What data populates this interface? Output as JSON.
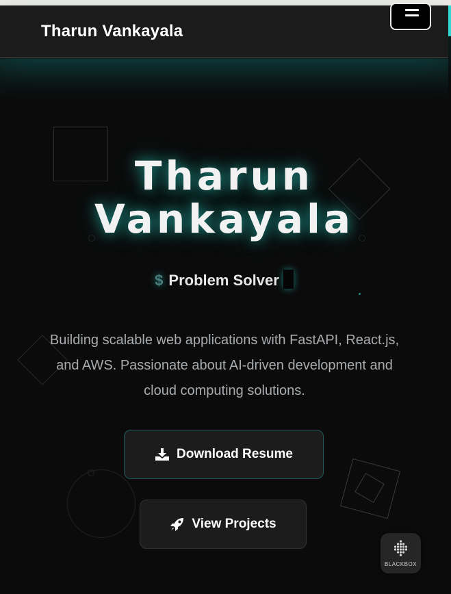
{
  "nav": {
    "brand": "Tharun Vankayala",
    "menu_icon": "hamburger-icon"
  },
  "hero": {
    "title_line1": "Tharun",
    "title_line2": "Vankayala",
    "prompt_symbol": "$",
    "role": "Problem Solver",
    "description": "Building scalable web applications with FastAPI, React.js, and AWS. Passionate about AI-driven development and cloud computing solutions."
  },
  "buttons": {
    "resume_label": "Download Resume",
    "resume_icon": "download-icon",
    "projects_label": "View Projects",
    "projects_icon": "rocket-icon"
  },
  "widget": {
    "label": "BLACKBOX"
  },
  "colors": {
    "background": "#0b0b0b",
    "navbar": "#1b1b1b",
    "accent": "#2fd6d2",
    "description_text": "#a9acaf"
  }
}
